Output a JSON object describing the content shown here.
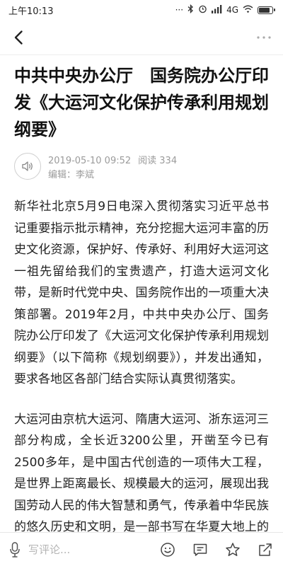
{
  "status": {
    "time": "上午10:13",
    "network": "4G",
    "battery_level": 0.85
  },
  "nav": {
    "back_icon": "chevron-left-icon",
    "more_icon": "more-horizontal-icon"
  },
  "article": {
    "title": "中共中央办公厅　国务院办公厅印发《大运河文化保护传承利用规划纲要》",
    "datetime": "2019-05-10 09:52",
    "reads": "阅读 334",
    "editor": "编辑：李斌",
    "paragraphs": [
      "新华社北京5月9日电深入贯彻落实习近平总书记重要指示批示精神，充分挖掘大运河丰富的历史文化资源，保护好、传承好、利用好大运河这一祖先留给我们的宝贵遗产，打造大运河文化带，是新时代党中央、国务院作出的一项重大决策部署。2019年2月，中共中央办公厅、国务院办公厅印发了《大运河文化保护传承利用规划纲要》（以下简称《规划纲要》），并发出通知，要求各地区各部门结合实际认真贯彻落实。",
      "大运河由京杭大运河、隋唐大运河、浙东运河三部分构成，全长近3200公里，开凿至今已有2500多年，是中国古代创造的一项伟大工程，是世界上距离最长、规模最大的运河，展现出我国劳动人民的伟大智慧和勇气，传承着中华民族的悠久历史和文明，是一部书写在华夏大地上的宏伟诗篇。保护好、传承好、利用好大运河"
    ]
  },
  "bottom_bar": {
    "comment_placeholder": "写评论..."
  }
}
